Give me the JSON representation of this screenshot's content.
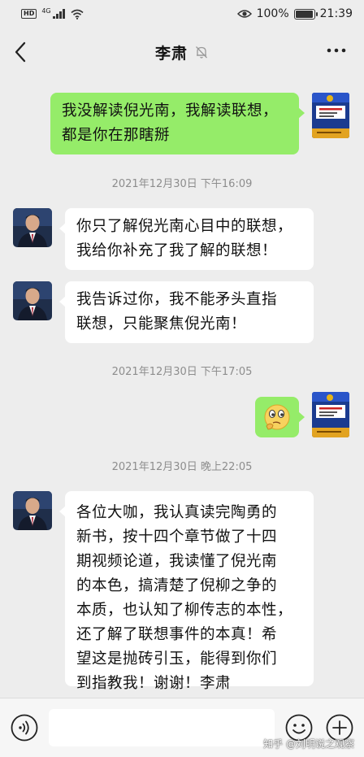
{
  "status_bar": {
    "hd": "HD",
    "network": "4G",
    "battery": "100%",
    "battery_level": 1.0,
    "time": "21:39"
  },
  "header": {
    "title": "李肃",
    "muted": true
  },
  "messages": [
    {
      "type": "sent",
      "text_lines": [
        "我没解读倪光南，我解读联想，",
        "都是你在那瞎掰"
      ]
    },
    {
      "type": "time",
      "text": "2021年12月30日 下午16:09"
    },
    {
      "type": "received",
      "sender": "李肃",
      "text_lines": [
        "你只了解倪光南心目中的联想，",
        "我给你补充了我了解的联想！"
      ]
    },
    {
      "type": "received",
      "sender": "李肃",
      "text_lines": [
        "我告诉过你，我不能矛头直指",
        "联想，只能聚焦倪光南！"
      ]
    },
    {
      "type": "time",
      "text": "2021年12月30日 下午17:05"
    },
    {
      "type": "sent_sticker",
      "sticker": "thinking-face-emoji"
    },
    {
      "type": "time",
      "text": "2021年12月30日 晚上22:05"
    },
    {
      "type": "received",
      "sender": "李肃",
      "text_lines": [
        "各位大咖，我认真读完陶勇的",
        "新书，按十四个章节做了十四",
        "期视频论道，我读懂了倪光南",
        "的本色，搞清楚了倪柳之争的",
        "本质，也认知了柳传志的本性，",
        "还了解了联想事件的本真！希",
        "望这是抛砖引玉，能得到你们",
        "到指教我！谢谢！李肃"
      ]
    }
  ],
  "input_bar": {
    "placeholder": ""
  },
  "watermark": "知乎 @刘明说之观察",
  "colors": {
    "background": "#ededed",
    "sent_bubble": "#95ec69",
    "received_bubble": "#ffffff",
    "timestamp": "#8d8d8d"
  }
}
